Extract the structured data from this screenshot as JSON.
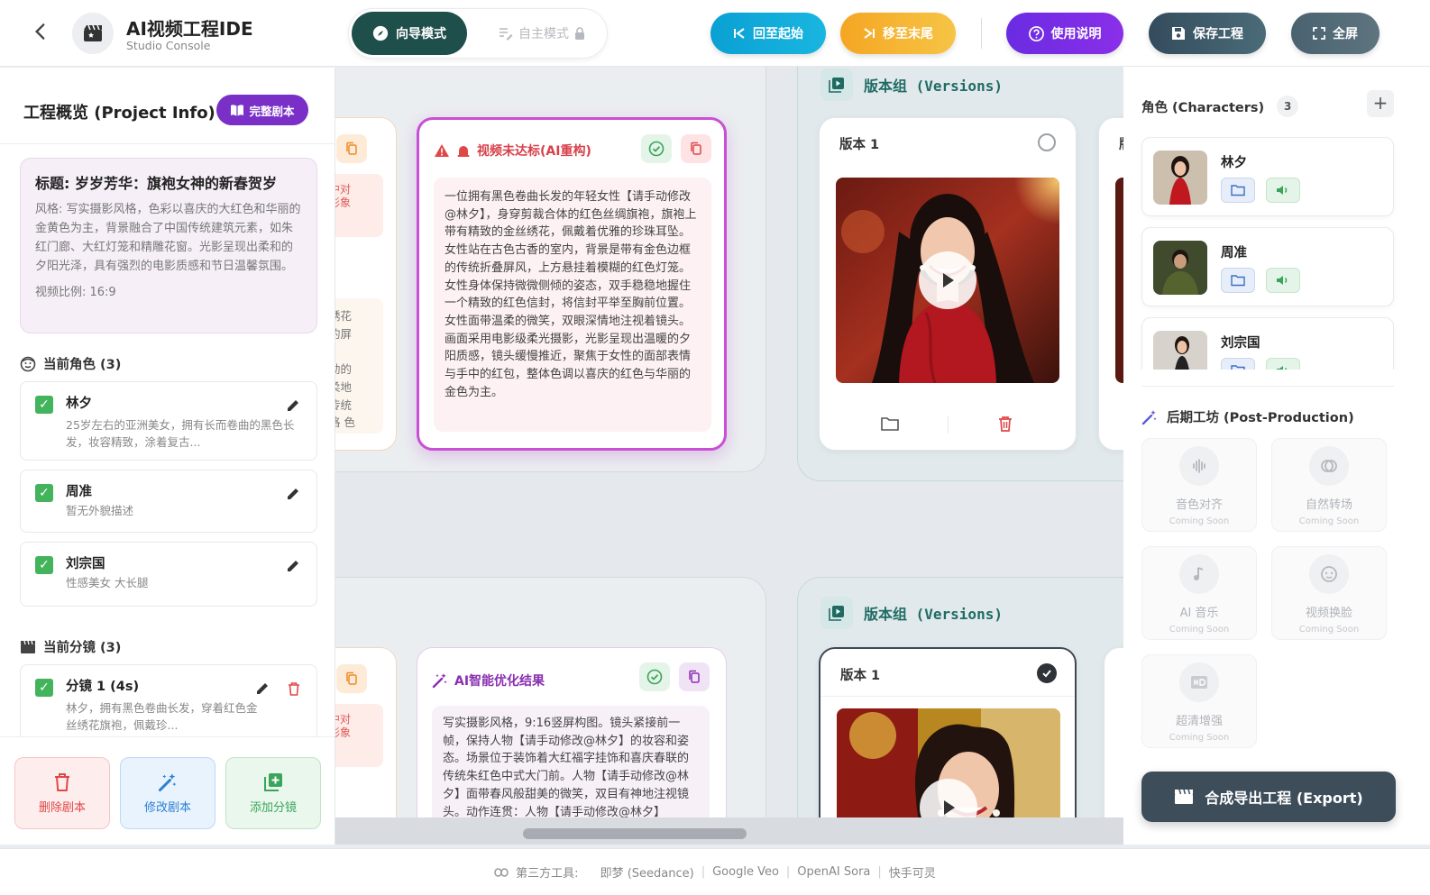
{
  "header": {
    "title": "AI视频工程IDE",
    "subtitle": "Studio Console",
    "mode_guided": "向导模式",
    "mode_free": "自主模式",
    "btn_start": "回至起始",
    "btn_end": "移至末尾",
    "btn_help": "使用说明",
    "btn_save": "保存工程",
    "btn_fullscreen": "全屏",
    "colors": {
      "guided": "#1f4f4b",
      "start": "#0fa3d6",
      "end": "#f5b523",
      "help": "#7a2be0",
      "save": "#3a5566",
      "fullscreen": "#4f6671"
    }
  },
  "left": {
    "title": "工程概览 (Project Info)",
    "full_script_btn": "完整剧本",
    "info": {
      "title": "标题: 岁岁芳华：旗袍女神的新春贺岁",
      "style": "风格: 写实摄影风格，色彩以喜庆的大红色和华丽的金黄色为主，背景融合了中国传统建筑元素，如朱红门廊、大红灯笼和精雕花窗。光影呈现出柔和的夕阳光泽，具有强烈的电影质感和节日温馨氛围。",
      "ratio": "视频比例: 16:9"
    },
    "characters_header": "当前角色 (3)",
    "characters": [
      {
        "name": "林夕",
        "desc": "25岁左右的亚洲美女，拥有长而卷曲的黑色长发，妆容精致，涂着复古..."
      },
      {
        "name": "周准",
        "desc": "暂无外貌描述"
      },
      {
        "name": "刘宗国",
        "desc": "性感美女 大长腿"
      }
    ],
    "shots_header": "当前分镜 (3)",
    "shots": [
      {
        "name": "分镜 1 (4s)",
        "desc": "林夕，拥有黑色卷曲长发，穿着红色金丝绣花旗袍，佩戴珍..."
      }
    ],
    "actions": {
      "delete": "删除剧本",
      "modify": "修改剧本",
      "add": "添加分镜"
    }
  },
  "canvas": {
    "node1": {
      "title": "视频未达标(AI重构)",
      "text": "一位拥有黑色卷曲长发的年轻女性【请手动修改@林夕】，身穿剪裁合体的红色丝绸旗袍，旗袍上带有精致的金丝绣花，佩戴着优雅的珍珠耳坠。女性站在古色古香的室内，背景是带有金色边框的传统折叠屏风，上方悬挂着模糊的红色灯笼。女性身体保持微微侧倾的姿态，双手稳稳地握住一个精致的红色信封，将信封平举至胸前位置。女性面带温柔的微笑，双眼深情地注视着镜头。画面采用电影级柔光摄影，光影呈现出温暖的夕阳质感，镜头缓慢推近，聚焦于女性的面部表情与手中的红包，整体色调以喜庆的红色与华丽的金色为主。"
    },
    "node2": {
      "title": "AI智能优化结果",
      "text": "写实摄影风格，9:16竖屏构图。镜头紧接前一帧，保持人物【请手动修改@林夕】的妆容和姿态。场景位于装饰着大红福字挂饰和喜庆春联的传统朱红色中式大门前。人物【请手动修改@林夕】面带春风般甜美的微笑，双目有神地注视镜头。动作连贯：人物【请手动修改@林夕】"
    },
    "partial_left_top": "中对\n形象",
    "partial_left_text": "绣花\n的屏\n\n勒的\n柔地\n传统\n格 色",
    "partial_left_bottom": "中对\n形象",
    "version_group_1": "版本组 (Versions)",
    "version_group_2": "版本组 (Versions)",
    "version_1a": "版本 1",
    "version_1b": "版本 1",
    "partial_version": "版"
  },
  "right": {
    "characters_title": "角色 (Characters)",
    "characters_count": "3",
    "characters": [
      {
        "name": "林夕"
      },
      {
        "name": "周准"
      },
      {
        "name": "刘宗国"
      }
    ],
    "post_title": "后期工坊 (Post-Production)",
    "tools": [
      {
        "name": "音色对齐",
        "status": "Coming Soon"
      },
      {
        "name": "自然转场",
        "status": "Coming Soon"
      },
      {
        "name": "AI 音乐",
        "status": "Coming Soon"
      },
      {
        "name": "视频换脸",
        "status": "Coming Soon"
      },
      {
        "name": "超清增强",
        "status": "Coming Soon"
      }
    ],
    "export": "合成导出工程 (Export)"
  },
  "footer": {
    "label": "第三方工具:",
    "tools": [
      "即梦 (Seedance)",
      "Google Veo",
      "OpenAI Sora",
      "快手可灵"
    ]
  }
}
